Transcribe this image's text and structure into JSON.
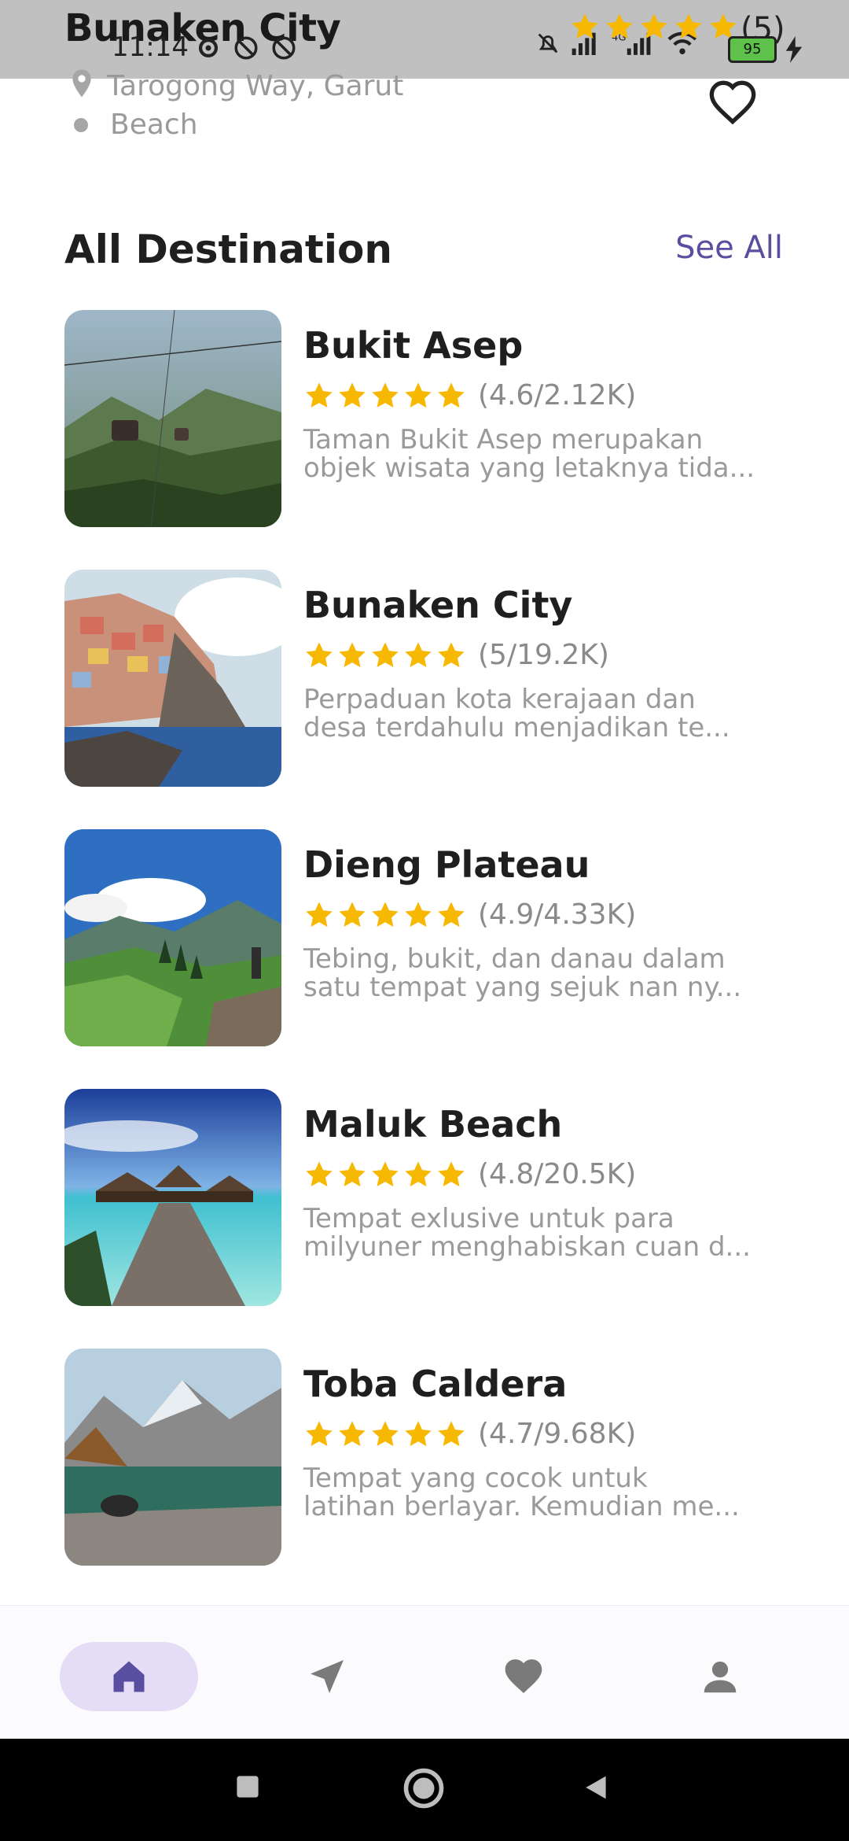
{
  "status_bar": {
    "overlay_title": "Bunaken City",
    "time": "11:14",
    "count": "(5)",
    "battery": "95",
    "network": "4G"
  },
  "header": {
    "location": "Tarogong Way, Garut",
    "category": "Beach"
  },
  "section": {
    "title": "All Destination",
    "see_all": "See All"
  },
  "destinations": [
    {
      "name": "Bukit Asep",
      "rating": "(4.6/2.12K)",
      "desc_line1": "Taman Bukit Asep merupakan",
      "desc_line2": "objek wisata yang letaknya tida..."
    },
    {
      "name": "Bunaken City",
      "rating": "(5/19.2K)",
      "desc_line1": "Perpaduan kota kerajaan dan",
      "desc_line2": "desa terdahulu menjadikan te..."
    },
    {
      "name": "Dieng Plateau",
      "rating": "(4.9/4.33K)",
      "desc_line1": "Tebing, bukit, dan danau dalam",
      "desc_line2": "satu tempat yang sejuk nan ny..."
    },
    {
      "name": "Maluk Beach",
      "rating": "(4.8/20.5K)",
      "desc_line1": "Tempat exlusive untuk para",
      "desc_line2": "milyuner menghabiskan cuan d..."
    },
    {
      "name": "Toba Caldera",
      "rating": "(4.7/9.68K)",
      "desc_line1": "Tempat yang cocok untuk",
      "desc_line2": "latihan berlayar. Kemudian me..."
    }
  ],
  "colors": {
    "accent": "#5a4ea0",
    "star": "#f6b800",
    "nav_active_bg": "#e5dcf6"
  },
  "icons": {
    "home": "home-icon",
    "explore": "navigation-icon",
    "favorite": "heart-icon",
    "profile": "person-icon"
  }
}
